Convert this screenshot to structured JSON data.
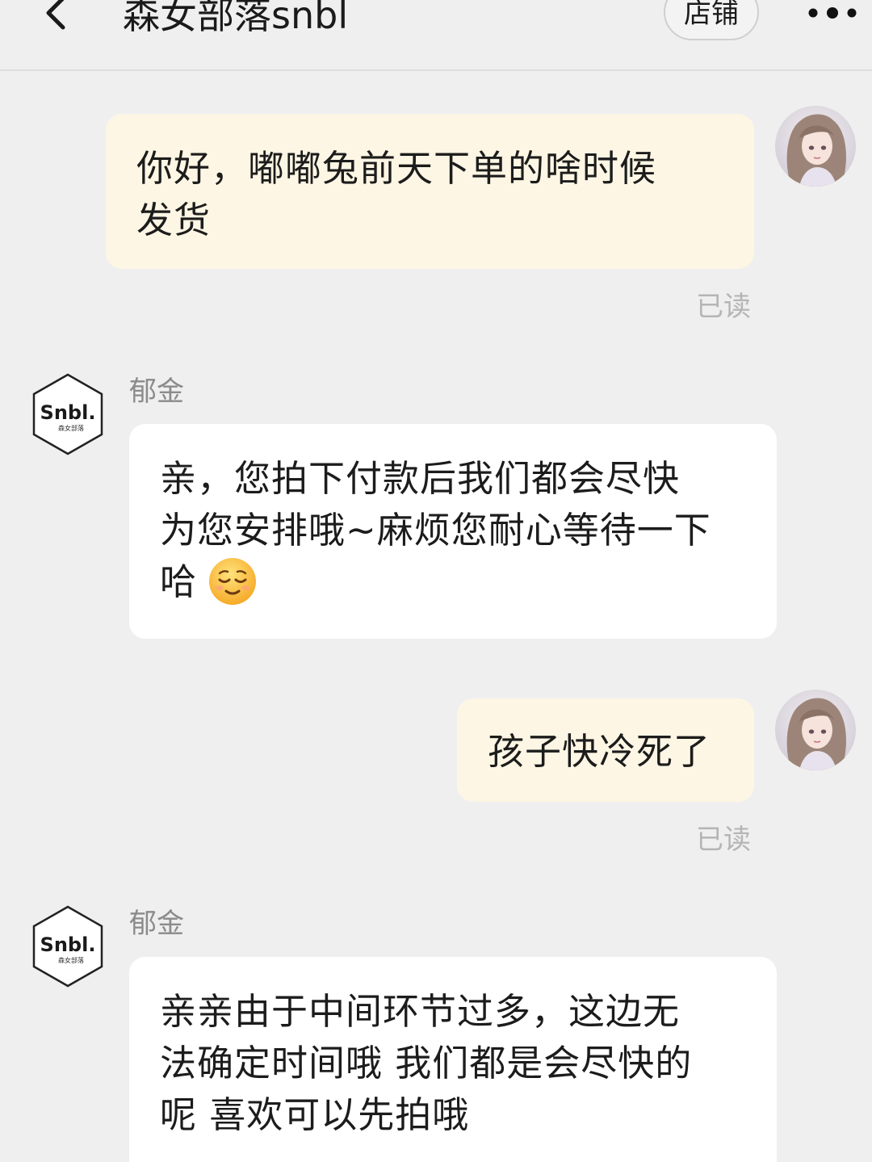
{
  "header": {
    "title": "森女部落snbl",
    "store_label": "店铺",
    "back_icon": "chevron-left-icon",
    "more_icon": "more-dots-icon"
  },
  "shop_avatar": {
    "logo_text": "Snbl.",
    "logo_subtext": "森女部落"
  },
  "messages": [
    {
      "direction": "outgoing",
      "lines": [
        "你好，嘟嘟兔前天下单的啥时候",
        "发货"
      ],
      "status": "已读"
    },
    {
      "direction": "incoming",
      "sender": "郁金",
      "lines": [
        "亲，您拍下付款后我们都会尽快",
        "为您安排哦~麻烦您耐心等待一下",
        "哈"
      ],
      "emoji": "relieved-face-emoji"
    },
    {
      "direction": "outgoing",
      "lines": [
        "孩子快冷死了"
      ],
      "status": "已读"
    },
    {
      "direction": "incoming",
      "sender": "郁金",
      "lines": [
        "亲亲由于中间环节过多，这边无",
        "法确定时间哦 我们都是会尽快的",
        "呢 喜欢可以先拍哦"
      ]
    }
  ],
  "colors": {
    "background": "#efefef",
    "outgoing_bubble": "#fdf6e4",
    "incoming_bubble": "#ffffff",
    "read_status": "#b5b5b5",
    "sender_name": "#8b8b8b"
  }
}
